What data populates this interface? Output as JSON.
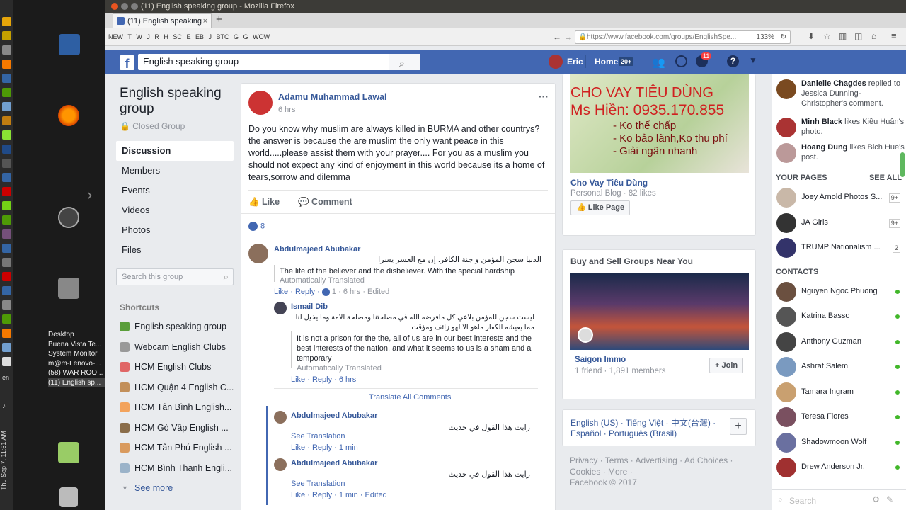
{
  "desktop": {
    "taskbar_windows": [
      "Desktop",
      "Buena Vista Te...",
      "System Monitor",
      "m@m-Lenovo-...",
      "(58) WAR ROO...",
      "(11) English sp..."
    ],
    "clock": "Thu Sep 7, 11:51 AM",
    "lang": "en"
  },
  "browser": {
    "window_title": "(11) English speaking group - Mozilla Firefox",
    "tab_title": "(11) English speaking",
    "url": "https://www.facebook.com/groups/EnglishSpe...",
    "zoom": "133%",
    "bookmarks": [
      "NEW",
      "T",
      "W",
      "J",
      "R",
      "H",
      "SC",
      "E",
      "EB",
      "J",
      "BTC",
      "G",
      "G",
      "WOW"
    ]
  },
  "header": {
    "search_value": "English speaking group",
    "user": "Eric",
    "home": "Home",
    "home_count": "20+",
    "notif_count": "11"
  },
  "group": {
    "name": "English speaking group",
    "privacy": "Closed Group",
    "nav": [
      "Discussion",
      "Members",
      "Events",
      "Videos",
      "Photos",
      "Files"
    ],
    "search_placeholder": "Search this group",
    "shortcuts_title": "Shortcuts",
    "shortcuts": [
      "English speaking group",
      "Webcam English Clubs",
      "HCM English Clubs",
      "HCM Quận 4 English C...",
      "HCM Tân Bình English...",
      "HCM Gò Vấp English ...",
      "HCM Tân Phú English ...",
      "HCM Bình Thạnh Engli..."
    ],
    "see_more": "See more"
  },
  "post": {
    "author": "Adamu Muhammad Lawal",
    "time": "6 hrs",
    "text": "Do you know why muslim are always killed in BURMA and other countrys? the answer is because the are muslim the only want peace in this world.....please assist them with your prayer.... For you as a muslim you should not expect any kind of enjoyment in this world because its a home of tears,sorrow and dilemma",
    "like": "Like",
    "comment": "Comment",
    "reactions": "8",
    "comments": [
      {
        "name": "Abdulmajeed Abubakar",
        "original": "الدنيا سجن المؤمن و جنة الكافر. إن مع العسر يسرا",
        "translated": "The life of the believer and the disbeliever. With the special hardship",
        "note": "Automatically Translated",
        "actions": "Like · Reply ·",
        "likes": "1",
        "meta": "· 6 hrs · Edited"
      },
      {
        "name": "Ismail Dib",
        "original": "ليست سجن للمؤمن بلاعي كل مافرضه الله في مصلحتنا ومصلحة الامة وما يخيل لنا مما يعيشه الكفار ماهو الا لهو زائف ومؤقت",
        "translated": "It is not a prison for the the, all of us are in our best interests and the best interests of the nation, and what it seems to us is a sham and a temporary",
        "note": "Automatically Translated",
        "actions": "Like · Reply · 6 hrs"
      },
      {
        "name": "Abdulmajeed Abubakar",
        "original": "رايت هذا القول في حديث",
        "see_translation": "See Translation",
        "actions": "Like · Reply · 1 min"
      },
      {
        "name": "Abdulmajeed Abubakar",
        "original": "رايت هذا القول في حديث",
        "see_translation": "See Translation",
        "actions": "Like · Reply · 1 min · Edited"
      }
    ],
    "translate_all": "Translate All Comments"
  },
  "ads": {
    "ad_title": "Cho Vay Tiêu Dùng",
    "ad_sub": "Personal Blog · 82 likes",
    "ad_image_text": [
      "CHO VAY TIÊU DÙNG",
      "Ms Hiền: 0935.170.855",
      "- Ko thế chấp",
      "- Ko bảo lãnh,Ko thu phí",
      "- Giải ngân nhanh"
    ],
    "like_page": "Like Page",
    "groups_title": "Buy and Sell Groups Near You",
    "group_name": "Saigon Immo",
    "group_meta": "1 friend · 1,891 members",
    "join": "+ Join",
    "languages": "English (US) · Tiếng Việt · 中文(台灣) · Español · Português (Brasil)",
    "footer": "Privacy · Terms · Advertising · Ad Choices · Cookies · More ·",
    "copyright": "Facebook © 2017"
  },
  "sidebar": {
    "activity": [
      {
        "name": "Danielle Chagdes",
        "text": "replied to Jessica Dunning-Christopher's comment."
      },
      {
        "name": "Minh Black",
        "text": "likes Kiều Huân's photo."
      },
      {
        "name": "Hoang Dung",
        "text": "likes Bich Hue's post."
      }
    ],
    "pages_title": "YOUR PAGES",
    "see_all": "SEE ALL",
    "pages": [
      {
        "name": "Joey Arnold Photos S...",
        "count": "9+"
      },
      {
        "name": "JA Girls",
        "count": "9+"
      },
      {
        "name": "TRUMP Nationalism ...",
        "count": "2"
      }
    ],
    "contacts_title": "CONTACTS",
    "contacts": [
      "Nguyen Ngoc Phuong",
      "Katrina Basso",
      "Anthony Guzman",
      "Ashraf Salem",
      "Tamara Ingram",
      "Teresa Flores",
      "Shadowmoon Wolf",
      "Drew Anderson Jr."
    ],
    "search_placeholder": "Search"
  },
  "colors": {
    "fb_blue": "#4267b2",
    "link": "#365899",
    "online": "#42b72a",
    "bg": "#e9ebee"
  }
}
